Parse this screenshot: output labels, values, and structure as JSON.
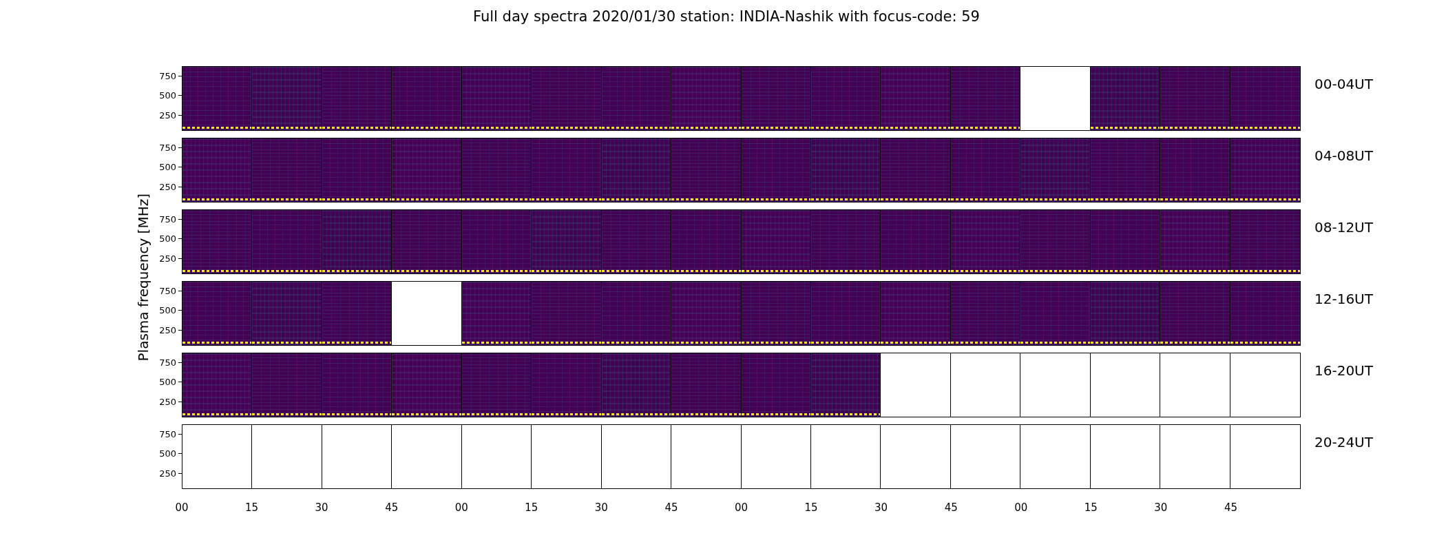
{
  "title": "Full day spectra 2020/01/30 station: INDIA-Nashik with focus-code: 59",
  "ylabel": "Plasma frequency [MHz]",
  "rows": [
    {
      "label": "00-04UT",
      "yticks": [
        "750",
        "500",
        "250"
      ],
      "panels": [
        {
          "kind": "spectrum"
        },
        {
          "kind": "spectrum"
        },
        {
          "kind": "spectrum"
        },
        {
          "kind": "spectrum"
        },
        {
          "kind": "spectrum"
        },
        {
          "kind": "spectrum"
        },
        {
          "kind": "spectrum"
        },
        {
          "kind": "spectrum"
        },
        {
          "kind": "spectrum"
        },
        {
          "kind": "spectrum"
        },
        {
          "kind": "spectrum"
        },
        {
          "kind": "spectrum"
        },
        {
          "kind": "empty"
        },
        {
          "kind": "spectrum"
        },
        {
          "kind": "spectrum"
        },
        {
          "kind": "spectrum"
        }
      ]
    },
    {
      "label": "04-08UT",
      "yticks": [
        "750",
        "500",
        "250"
      ],
      "panels": [
        {
          "kind": "spectrum"
        },
        {
          "kind": "spectrum"
        },
        {
          "kind": "spectrum"
        },
        {
          "kind": "spectrum"
        },
        {
          "kind": "spectrum"
        },
        {
          "kind": "spectrum"
        },
        {
          "kind": "spectrum"
        },
        {
          "kind": "spectrum"
        },
        {
          "kind": "spectrum"
        },
        {
          "kind": "spectrum"
        },
        {
          "kind": "spectrum"
        },
        {
          "kind": "spectrum"
        },
        {
          "kind": "spectrum"
        },
        {
          "kind": "spectrum"
        },
        {
          "kind": "spectrum"
        },
        {
          "kind": "spectrum"
        }
      ]
    },
    {
      "label": "08-12UT",
      "yticks": [
        "750",
        "500",
        "250"
      ],
      "panels": [
        {
          "kind": "spectrum"
        },
        {
          "kind": "spectrum"
        },
        {
          "kind": "spectrum"
        },
        {
          "kind": "spectrum"
        },
        {
          "kind": "spectrum"
        },
        {
          "kind": "spectrum"
        },
        {
          "kind": "spectrum"
        },
        {
          "kind": "spectrum"
        },
        {
          "kind": "spectrum"
        },
        {
          "kind": "spectrum"
        },
        {
          "kind": "spectrum"
        },
        {
          "kind": "spectrum"
        },
        {
          "kind": "spectrum"
        },
        {
          "kind": "spectrum"
        },
        {
          "kind": "spectrum"
        },
        {
          "kind": "spectrum"
        }
      ]
    },
    {
      "label": "12-16UT",
      "yticks": [
        "750",
        "500",
        "250"
      ],
      "panels": [
        {
          "kind": "spectrum"
        },
        {
          "kind": "spectrum"
        },
        {
          "kind": "spectrum"
        },
        {
          "kind": "empty"
        },
        {
          "kind": "spectrum"
        },
        {
          "kind": "spectrum"
        },
        {
          "kind": "spectrum"
        },
        {
          "kind": "spectrum"
        },
        {
          "kind": "spectrum"
        },
        {
          "kind": "spectrum"
        },
        {
          "kind": "spectrum"
        },
        {
          "kind": "spectrum"
        },
        {
          "kind": "spectrum"
        },
        {
          "kind": "spectrum"
        },
        {
          "kind": "spectrum"
        },
        {
          "kind": "spectrum"
        }
      ]
    },
    {
      "label": "16-20UT",
      "yticks": [
        "750",
        "500",
        "250"
      ],
      "panels": [
        {
          "kind": "spectrum"
        },
        {
          "kind": "spectrum"
        },
        {
          "kind": "spectrum"
        },
        {
          "kind": "spectrum"
        },
        {
          "kind": "spectrum"
        },
        {
          "kind": "spectrum"
        },
        {
          "kind": "spectrum"
        },
        {
          "kind": "spectrum"
        },
        {
          "kind": "spectrum"
        },
        {
          "kind": "spectrum"
        },
        {
          "kind": "empty"
        },
        {
          "kind": "empty"
        },
        {
          "kind": "empty"
        },
        {
          "kind": "empty"
        },
        {
          "kind": "empty"
        },
        {
          "kind": "empty"
        }
      ]
    },
    {
      "label": "20-24UT",
      "yticks": [
        "750",
        "500",
        "250"
      ],
      "panels": [
        {
          "kind": "empty"
        },
        {
          "kind": "empty"
        },
        {
          "kind": "empty"
        },
        {
          "kind": "empty"
        },
        {
          "kind": "empty"
        },
        {
          "kind": "empty"
        },
        {
          "kind": "empty"
        },
        {
          "kind": "empty"
        },
        {
          "kind": "empty"
        },
        {
          "kind": "empty"
        },
        {
          "kind": "empty"
        },
        {
          "kind": "empty"
        },
        {
          "kind": "empty"
        },
        {
          "kind": "empty"
        },
        {
          "kind": "empty"
        },
        {
          "kind": "empty"
        }
      ]
    }
  ],
  "xticks": [
    "00",
    "15",
    "30",
    "45",
    "00",
    "15",
    "30",
    "45",
    "00",
    "15",
    "30",
    "45",
    "00",
    "15",
    "30",
    "45"
  ]
}
